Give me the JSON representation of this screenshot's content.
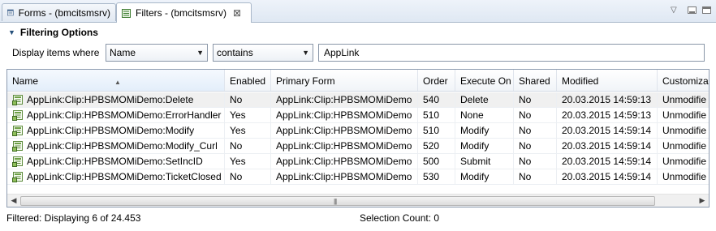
{
  "tabs": [
    {
      "label": "Forms - (bmcitsmsrv)",
      "icon": "form-grid-icon",
      "active": false
    },
    {
      "label": "Filters - (bmcitsmsrv)",
      "icon": "filter-list-icon",
      "active": true,
      "close": "⊠"
    }
  ],
  "window_controls": {
    "view_menu": "▽",
    "minimize": "minimize-icon",
    "maximize": "maximize-icon"
  },
  "filtering": {
    "title": "Filtering Options",
    "label": "Display items where",
    "field": "Name",
    "operator": "contains",
    "value": "AppLink"
  },
  "table": {
    "columns": [
      "Name",
      "Enabled",
      "Primary Form",
      "Order",
      "Execute On",
      "Shared",
      "Modified",
      "Customiza"
    ],
    "rows": [
      [
        "AppLink:Clip:HPBSMOMiDemo:Delete",
        "No",
        "AppLink:Clip:HPBSMOMiDemo",
        "540",
        "Delete",
        "No",
        "20.03.2015 14:59:13",
        "Unmodifie"
      ],
      [
        "AppLink:Clip:HPBSMOMiDemo:ErrorHandler",
        "Yes",
        "AppLink:Clip:HPBSMOMiDemo",
        "510",
        "None",
        "No",
        "20.03.2015 14:59:13",
        "Unmodifie"
      ],
      [
        "AppLink:Clip:HPBSMOMiDemo:Modify",
        "Yes",
        "AppLink:Clip:HPBSMOMiDemo",
        "510",
        "Modify",
        "No",
        "20.03.2015 14:59:14",
        "Unmodifie"
      ],
      [
        "AppLink:Clip:HPBSMOMiDemo:Modify_Curl",
        "No",
        "AppLink:Clip:HPBSMOMiDemo",
        "520",
        "Modify",
        "No",
        "20.03.2015 14:59:14",
        "Unmodifie"
      ],
      [
        "AppLink:Clip:HPBSMOMiDemo:SetIncID",
        "Yes",
        "AppLink:Clip:HPBSMOMiDemo",
        "500",
        "Submit",
        "No",
        "20.03.2015 14:59:14",
        "Unmodifie"
      ],
      [
        "AppLink:Clip:HPBSMOMiDemo:TicketClosed",
        "No",
        "AppLink:Clip:HPBSMOMiDemo",
        "530",
        "Modify",
        "No",
        "20.03.2015 14:59:14",
        "Unmodifie"
      ]
    ],
    "row_icon": "filter-object-icon"
  },
  "status": {
    "filtered": "Filtered: Displaying 6 of 24.453",
    "selection": "Selection Count: 0"
  },
  "colors": {
    "accent": "#244e79",
    "selected_row": "#f0f0f0"
  }
}
